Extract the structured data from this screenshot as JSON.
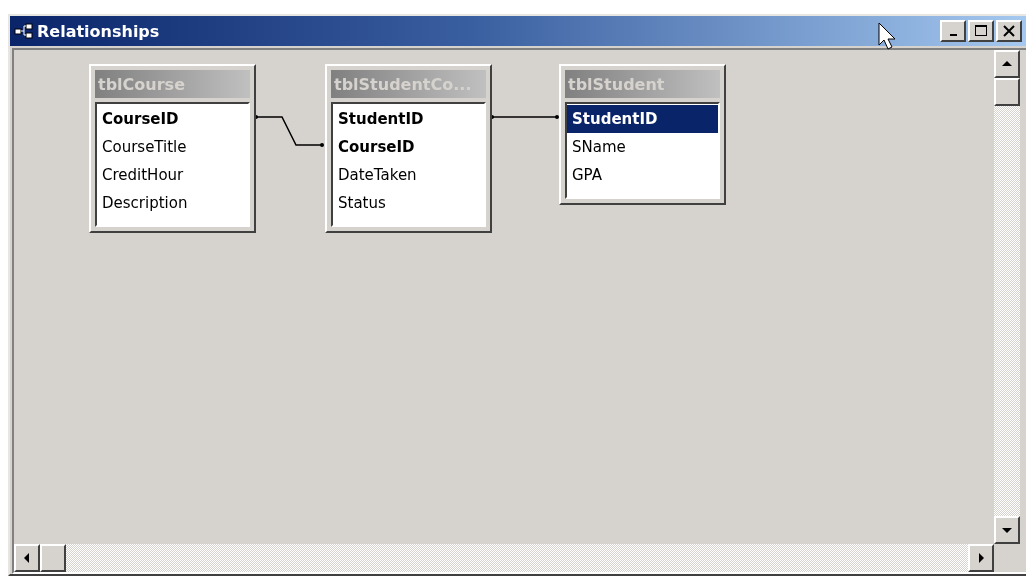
{
  "window": {
    "title": "Relationships"
  },
  "tables": [
    {
      "name": "tblCourse",
      "fields": [
        {
          "name": "CourseID",
          "key": true,
          "selected": false
        },
        {
          "name": "CourseTitle",
          "key": false,
          "selected": false
        },
        {
          "name": "CreditHour",
          "key": false,
          "selected": false
        },
        {
          "name": "Description",
          "key": false,
          "selected": false
        }
      ]
    },
    {
      "name": "tblStudentCo...",
      "fields": [
        {
          "name": "StudentID",
          "key": true,
          "selected": false
        },
        {
          "name": "CourseID",
          "key": true,
          "selected": false
        },
        {
          "name": "DateTaken",
          "key": false,
          "selected": false
        },
        {
          "name": "Status",
          "key": false,
          "selected": false
        }
      ]
    },
    {
      "name": "tblStudent",
      "fields": [
        {
          "name": "StudentID",
          "key": true,
          "selected": true
        },
        {
          "name": "SName",
          "key": false,
          "selected": false
        },
        {
          "name": "GPA",
          "key": false,
          "selected": false
        }
      ]
    }
  ]
}
